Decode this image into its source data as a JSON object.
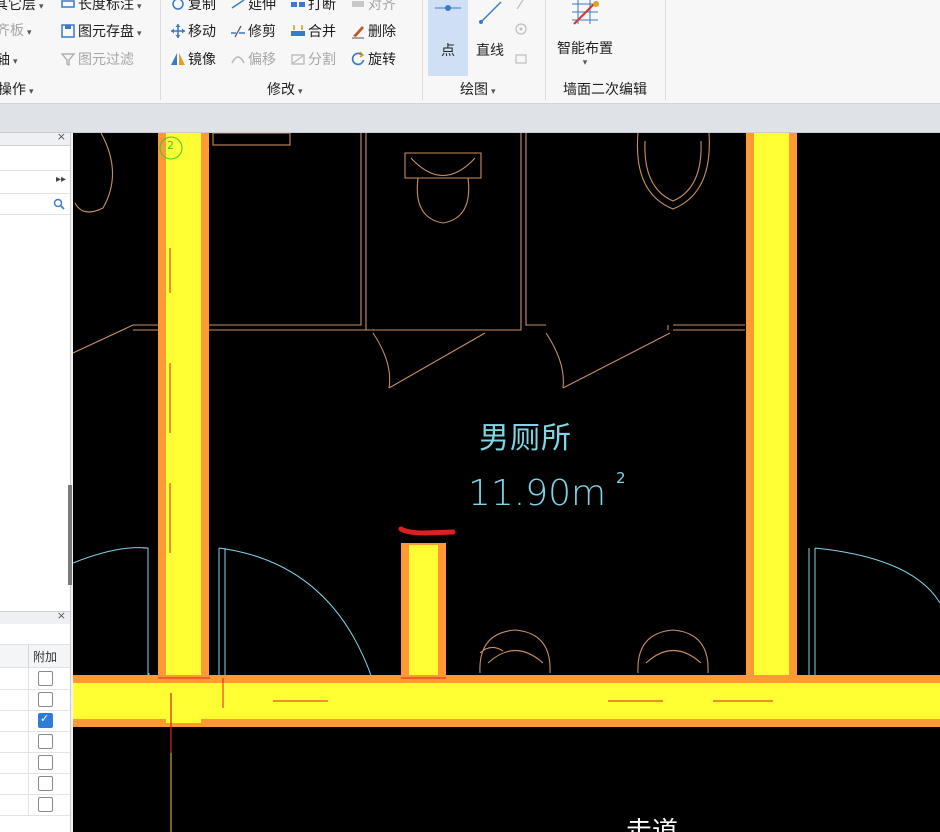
{
  "ribbon": {
    "layer_ops": {
      "row1": "其它层",
      "row2": "齐板",
      "row3": "轴",
      "group": "操作"
    },
    "length_label": "长度标注",
    "element_save": "图元存盘",
    "element_filter": "图元过滤",
    "modify": {
      "copy": "复制",
      "extend": "延伸",
      "break": "打断",
      "align": "对齐",
      "move": "移动",
      "trim": "修剪",
      "merge": "合并",
      "delete": "删除",
      "mirror": "镜像",
      "offset": "偏移",
      "split": "分割",
      "rotate": "旋转",
      "group": "修改"
    },
    "draw": {
      "point": "点",
      "line": "直线",
      "group": "绘图"
    },
    "wall_edit": {
      "smart_layout": "智能布置",
      "group": "墙面二次编辑"
    }
  },
  "left_panel": {
    "column_header": "附加",
    "checkboxes": [
      false,
      false,
      true,
      false,
      false,
      false,
      false
    ]
  },
  "canvas": {
    "room_name": "男厕所",
    "area_value": "11.90m",
    "area_superscript": "2",
    "corridor_label": "走道",
    "axis_marker": "2"
  },
  "colors": {
    "wall_core": "#ffff33",
    "wall_edge": "#ff9933",
    "fixture_line": "#c89060",
    "door_swing": "#7fd6e6",
    "annotation_red": "#e02020",
    "canvas_bg": "#000000"
  }
}
